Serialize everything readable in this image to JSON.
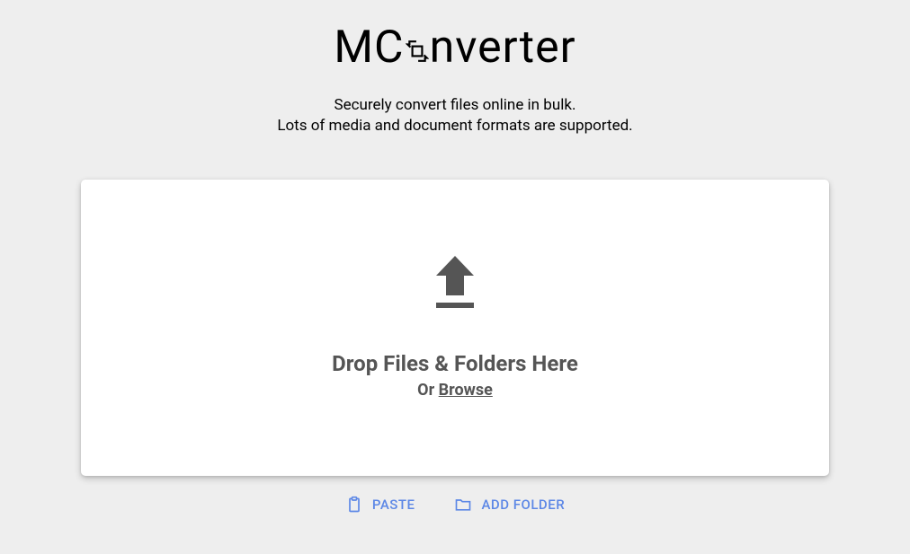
{
  "header": {
    "logo_prefix": "MC",
    "logo_suffix": "nverter",
    "tagline_line1": "Securely convert files online in bulk.",
    "tagline_line2": "Lots of media and document formats are supported."
  },
  "dropzone": {
    "main_text": "Drop Files & Folders Here",
    "or_text": "Or ",
    "browse_text": "Browse"
  },
  "actions": {
    "paste_label": "PASTE",
    "add_folder_label": "ADD FOLDER"
  }
}
